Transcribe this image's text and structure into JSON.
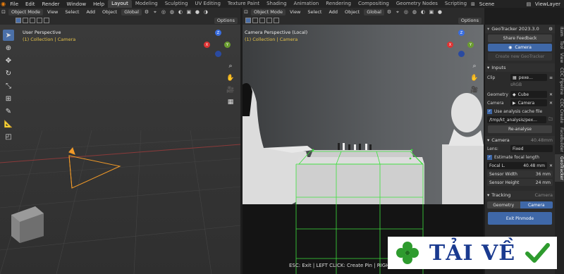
{
  "topbar": {
    "menus": [
      "File",
      "Edit",
      "Render",
      "Window",
      "Help"
    ],
    "workspaces": [
      "Layout",
      "Modeling",
      "Sculpting",
      "UV Editing",
      "Texture Paint",
      "Shading",
      "Animation",
      "Rendering",
      "Compositing",
      "Geometry Nodes",
      "Scripting"
    ],
    "active_workspace": "Layout",
    "scene": "Scene",
    "view_layer": "ViewLayer"
  },
  "left_header": {
    "mode": "Object Mode",
    "menus": [
      "View",
      "Select",
      "Add",
      "Object"
    ],
    "orientation": "Global",
    "options": "Options"
  },
  "right_header": {
    "mode": "Object Mode",
    "menus": [
      "View",
      "Select",
      "Add",
      "Object"
    ],
    "orientation": "Global",
    "options": "Options"
  },
  "left_viewport": {
    "title": "User Perspective",
    "collection": "(1) Collection | Camera"
  },
  "right_viewport": {
    "title": "Camera Perspective (Local)",
    "collection": "(1) Collection | Camera"
  },
  "gizmo": {
    "x": "X",
    "y": "Y",
    "z": "Z"
  },
  "panel": {
    "title": "GeoTracker 2023.3.0",
    "share_feedback": "Share Feedback",
    "camera_btn": "Camera",
    "create_new": "Create new GeoTracker",
    "inputs": {
      "heading": "Inputs",
      "clip_label": "Clip",
      "clip_value": "pexe...",
      "clip_sub": "sRGB",
      "geometry_label": "Geometry",
      "geometry_value": "Cube",
      "camera_label": "Camera",
      "camera_value": "Camera",
      "cache_label": "Use analysis cache file",
      "cache_path": "/tmp/kt_analysis/pex...",
      "reanalyse": "Re-analyse"
    },
    "camera_section": {
      "heading": "Camera",
      "heading_value": "40.48mm",
      "lens_label": "Lens:",
      "lens_value": "Fixed",
      "estimate": "Estimate focal length",
      "focal_label": "Focal L.",
      "focal_value": "40.48 mm",
      "sensor_w_label": "Sensor Width",
      "sensor_w_value": "36 mm",
      "sensor_h_label": "Sensor Height",
      "sensor_h_value": "24 mm"
    },
    "tracking": {
      "heading": "Tracking",
      "heading_value": "Camera",
      "geometry_btn": "Geometry",
      "camera_btn": "Camera",
      "exit_pinmode": "Exit Pinmode"
    }
  },
  "side_tabs": [
    "Item",
    "Tool",
    "View",
    "CDC Pipeline",
    "CDC Create",
    "FaceBuilder",
    "GeoTracker"
  ],
  "active_tab": "GeoTracker",
  "status": "ESC: Exit | LEFT CLICK: Create Pin | RIGHT CLICK: Delete Pin | TAB: T",
  "watermark": "TẢI VỀ"
}
